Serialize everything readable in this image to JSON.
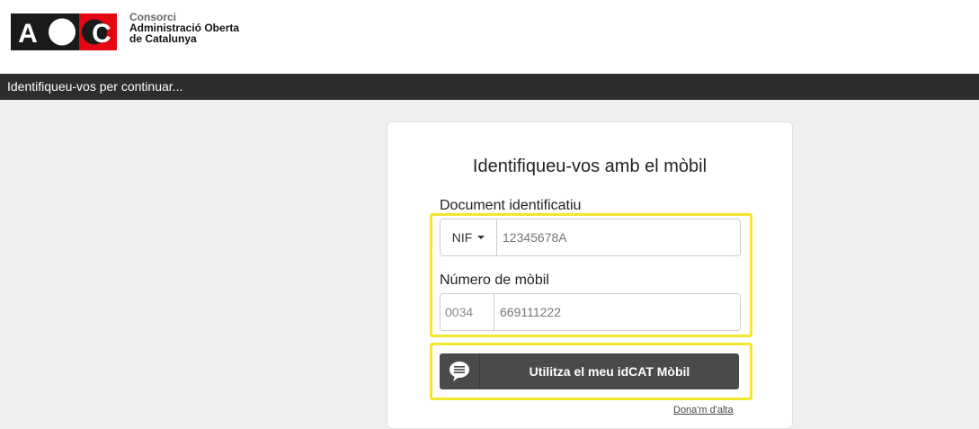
{
  "org": {
    "logo_text": "AOC",
    "name_line1": "Consorci",
    "name_line2": "Administració Oberta",
    "name_line3": "de Catalunya"
  },
  "banner": {
    "text": "Identifiqueu-vos per continuar..."
  },
  "form": {
    "title": "Identifiqueu-vos amb el mòbil",
    "doc_label": "Document identificatiu",
    "doc_type": "NIF",
    "doc_placeholder": "12345678A",
    "mobile_label": "Número de mòbil",
    "country_code": "0034",
    "mobile_placeholder": "669111222",
    "submit_label": "Utilitza el meu idCAT Mòbil",
    "register_link": "Dona'm d'alta"
  },
  "colors": {
    "highlight": "#f3e62c",
    "banner_bg": "#2d2d2d",
    "button_bg": "#4a4a4a",
    "logo_red": "#e30613"
  },
  "icons": {
    "submit_icon": "speech-bubble-icon",
    "dropdown_icon": "caret-down-icon"
  }
}
